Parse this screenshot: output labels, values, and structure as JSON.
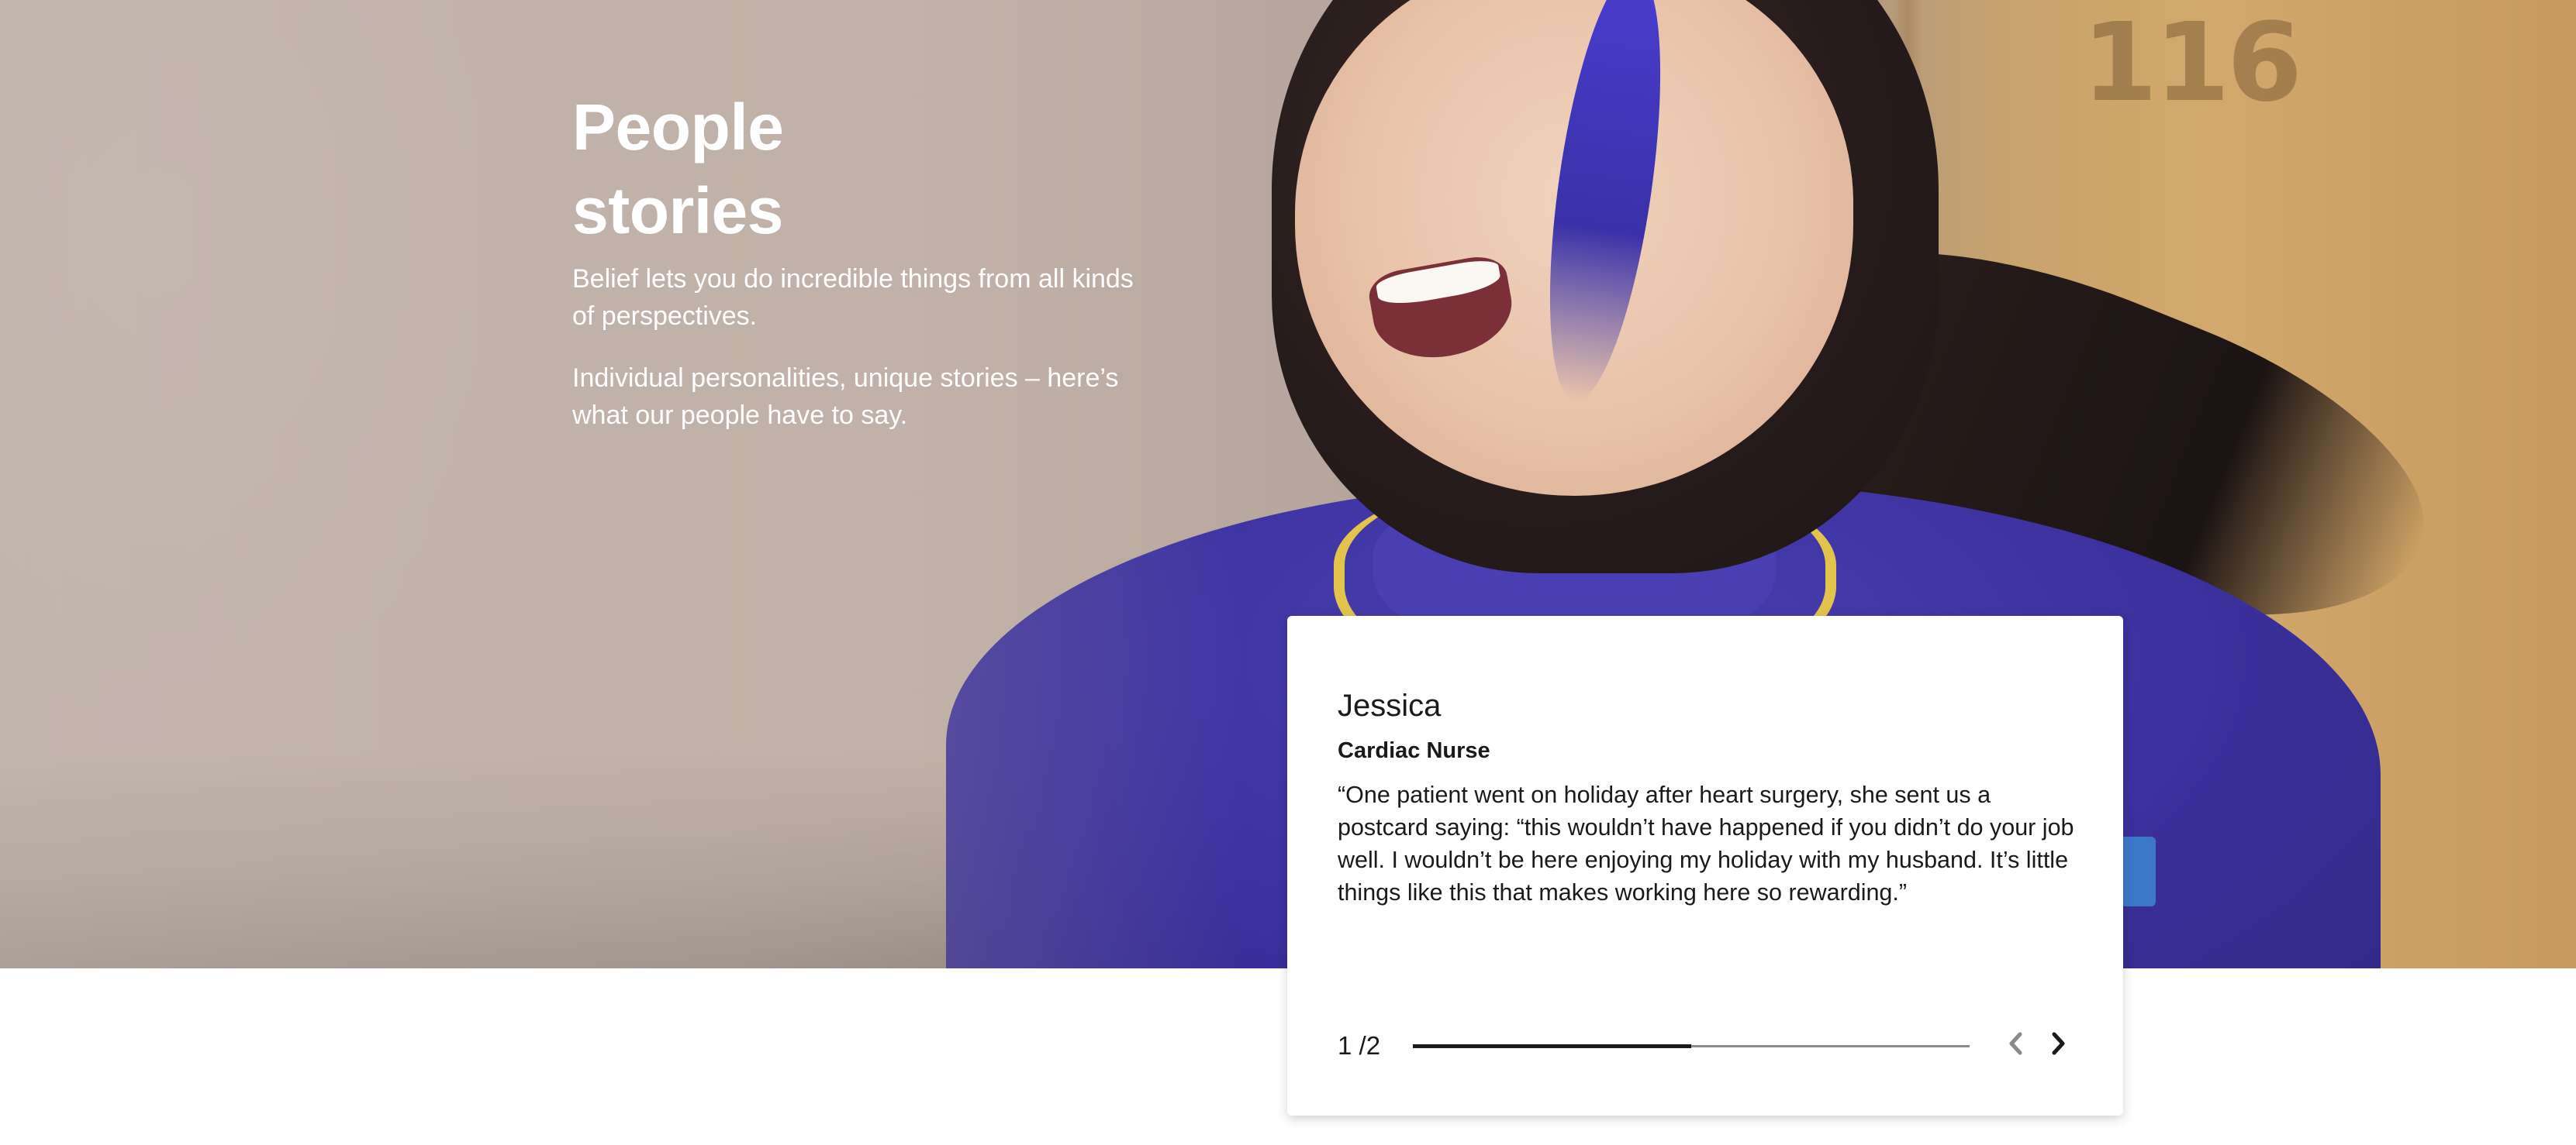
{
  "hero": {
    "title_line1": "People",
    "title_line2": "stories",
    "paragraph1": "Belief lets you do incredible things from all kinds of perspectives.",
    "paragraph2": "Individual personalities, unique stories – here’s what our people have to say.",
    "background_icon": "photo-nurse-laughing"
  },
  "story": {
    "name": "Jessica",
    "role": "Cardiac Nurse",
    "quote": "“One patient went on holiday after heart surgery, she sent us a postcard saying: “this wouldn’t have happened if you didn’t do your job well. I wouldn’t be here enjoying my holiday with my husband. It’s little things like this that makes working here so rewarding.”",
    "pager": "1 /2",
    "progress": 0.5,
    "prev_icon": "chevron-left-icon",
    "next_icon": "chevron-right-icon"
  },
  "colors": {
    "text_dark": "#1a1a1a",
    "progress_track": "#8a8a8a",
    "prev_disabled": "#8a8a8a",
    "shirt": "#3b309c"
  }
}
